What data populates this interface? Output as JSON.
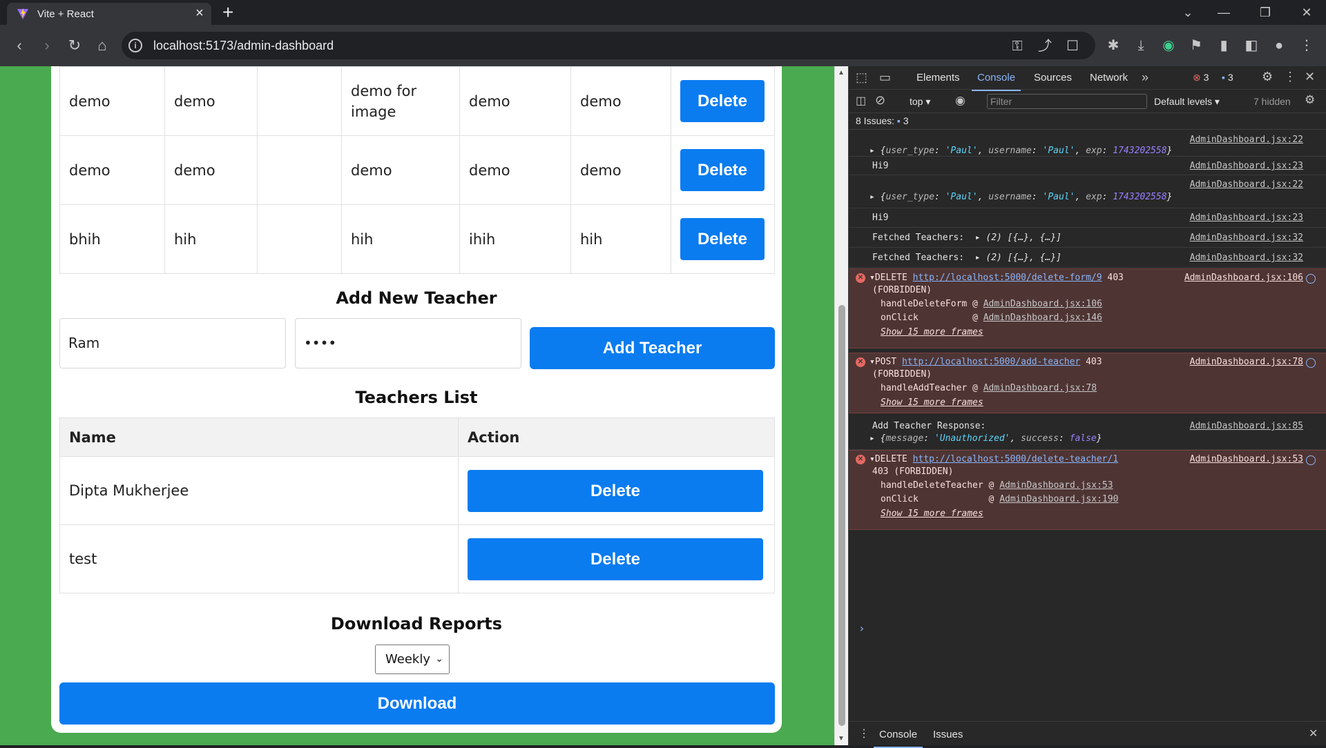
{
  "browser": {
    "tab_title": "Vite + React",
    "url": "localhost:5173/admin-dashboard"
  },
  "page": {
    "forms_rows": [
      {
        "c1": "demo",
        "c2": "demo",
        "c3": "",
        "c4": "demo for image",
        "c5": "demo",
        "c6": "demo",
        "action": "Delete"
      },
      {
        "c1": "demo",
        "c2": "demo",
        "c3": "",
        "c4": "demo",
        "c5": "demo",
        "c6": "demo",
        "action": "Delete"
      },
      {
        "c1": "bhih",
        "c2": "hih",
        "c3": "",
        "c4": "hih",
        "c5": "ihih",
        "c6": "hih",
        "action": "Delete"
      }
    ],
    "add_teacher": {
      "heading": "Add New Teacher",
      "name_value": "Ram",
      "password_value": "••••",
      "button": "Add Teacher"
    },
    "teachers_list": {
      "heading": "Teachers List",
      "col_name": "Name",
      "col_action": "Action",
      "rows": [
        {
          "name": "Dipta Mukherjee",
          "action": "Delete"
        },
        {
          "name": "test",
          "action": "Delete"
        }
      ]
    },
    "reports": {
      "heading": "Download Reports",
      "selected": "Weekly",
      "button": "Download"
    }
  },
  "devtools": {
    "tabs": [
      "Elements",
      "Console",
      "Sources",
      "Network"
    ],
    "active_tab": "Console",
    "error_count": "3",
    "message_count": "3",
    "context": "top",
    "filter_placeholder": "Filter",
    "levels": "Default levels",
    "hidden": "7 hidden",
    "issues_label": "8 Issues:",
    "issues_count": "3",
    "bottom_tabs": [
      "Console",
      "Issues"
    ],
    "messages": {
      "m1_src": "AdminDashboard.jsx:22",
      "m2_src": "AdminDashboard.jsx:23",
      "m2_text": "Hi9",
      "m3_src": "AdminDashboard.jsx:22",
      "m4_src": "AdminDashboard.jsx:23",
      "m4_text": "Hi9",
      "m5_text": "Fetched Teachers:",
      "m5_src": "AdminDashboard.jsx:32",
      "m6_text": "Fetched Teachers:",
      "m6_src": "AdminDashboard.jsx:32",
      "fetched_preview": "(2) [{…}, {…}]",
      "obj_user_type": "'Paul'",
      "obj_username": "'Paul'",
      "obj_exp": "1743202558",
      "e1_method": "DELETE",
      "e1_url": "http://localhost:5000/delete-form/9",
      "e1_status": "403",
      "e1_status_text": "(FORBIDDEN)",
      "e1_src": "AdminDashboard.jsx:106",
      "e1_f1": "handleDeleteForm",
      "e1_f1_src": "AdminDashboard.jsx:106",
      "e1_f2": "onClick",
      "e1_f2_src": "AdminDashboard.jsx:146",
      "more_frames": "Show 15 more frames",
      "e2_method": "POST",
      "e2_url": "http://localhost:5000/add-teacher",
      "e2_status": "403",
      "e2_status_text": "(FORBIDDEN)",
      "e2_src": "AdminDashboard.jsx:78",
      "e2_f1": "handleAddTeacher",
      "e2_f1_src": "AdminDashboard.jsx:78",
      "m7_text": "Add Teacher Response:",
      "m7_src": "AdminDashboard.jsx:85",
      "m7_message": "'Unauthorized'",
      "m7_success": "false",
      "e3_method": "DELETE",
      "e3_url": "http://localhost:5000/delete-teacher/1",
      "e3_status_line": "403 (FORBIDDEN)",
      "e3_src": "AdminDashboard.jsx:53",
      "e3_f1": "handleDeleteTeacher",
      "e3_f1_src": "AdminDashboard.jsx:53",
      "e3_f2": "onClick",
      "e3_f2_src": "AdminDashboard.jsx:190"
    }
  },
  "colors": {
    "page_background": "#4aaa4f",
    "primary_button": "#0a7cf0",
    "devtools_error_bg": "#4e3534"
  }
}
